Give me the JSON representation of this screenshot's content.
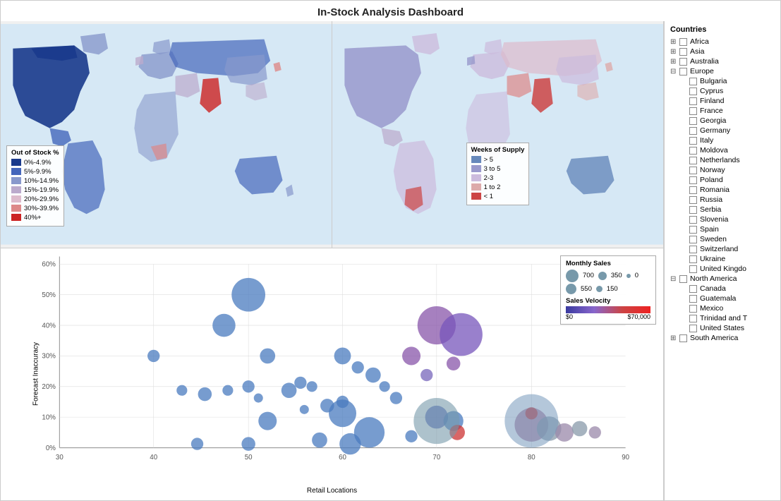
{
  "title": "In-Stock Analysis Dashboard",
  "maps": {
    "left_legend": {
      "title": "Out of Stock %",
      "items": [
        {
          "label": "0%-4.9%",
          "color": "#1a3a8c"
        },
        {
          "label": "5%-9.9%",
          "color": "#4466bb"
        },
        {
          "label": "10%-14.9%",
          "color": "#8899cc"
        },
        {
          "label": "15%-19.9%",
          "color": "#bbaacc"
        },
        {
          "label": "20%-29.9%",
          "color": "#ddbbcc"
        },
        {
          "label": "30%-39.9%",
          "color": "#dd8888"
        },
        {
          "label": "40%+",
          "color": "#cc2222"
        }
      ]
    },
    "right_legend": {
      "title": "Weeks of Supply",
      "items": [
        {
          "label": "> 5",
          "color": "#6688bb"
        },
        {
          "label": "3 to 5",
          "color": "#9999cc"
        },
        {
          "label": "2-3",
          "color": "#ccbbdd"
        },
        {
          "label": "1 to 2",
          "color": "#ddaaaa"
        },
        {
          "label": "< 1",
          "color": "#cc4444"
        }
      ]
    }
  },
  "scatter": {
    "x_label": "Retail Locations",
    "y_label": "Forecast Inaccuracy",
    "x_min": 30,
    "x_max": 90,
    "y_min": 0,
    "y_max": 60,
    "monthly_sales_legend": {
      "title": "Monthly Sales",
      "values": [
        "700",
        "550",
        "350",
        "150",
        "0"
      ]
    },
    "velocity_legend": {
      "title": "Sales Velocity",
      "min": "$0",
      "max": "$70,000"
    }
  },
  "countries_panel": {
    "title": "Countries",
    "groups": [
      {
        "name": "Africa",
        "expanded": false,
        "children": []
      },
      {
        "name": "Asia",
        "expanded": false,
        "children": []
      },
      {
        "name": "Australia",
        "expanded": false,
        "children": []
      },
      {
        "name": "Europe",
        "expanded": true,
        "children": [
          "Bulgaria",
          "Cyprus",
          "Finland",
          "France",
          "Georgia",
          "Germany",
          "Italy",
          "Moldova",
          "Netherlands",
          "Norway",
          "Poland",
          "Romania",
          "Russia",
          "Serbia",
          "Slovenia",
          "Spain",
          "Sweden",
          "Switzerland",
          "Ukraine",
          "United Kingdo"
        ]
      },
      {
        "name": "North America",
        "expanded": true,
        "children": [
          "Canada",
          "Guatemala",
          "Mexico",
          "Trinidad and T",
          "United States"
        ]
      },
      {
        "name": "South America",
        "expanded": false,
        "children": []
      }
    ]
  }
}
